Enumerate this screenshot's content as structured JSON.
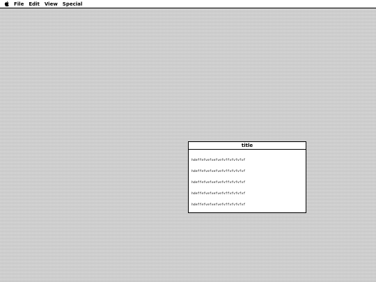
{
  "menubar": {
    "apple_icon": "apple-icon",
    "items": [
      {
        "label": "File"
      },
      {
        "label": "Edit"
      },
      {
        "label": "View"
      },
      {
        "label": "Special"
      }
    ]
  },
  "window": {
    "title": "title",
    "lines": [
      "hdeffefvefvefvefvffvfvfvfvf",
      "hdeffefvefvefvefvffvfvfvfvf",
      "hdeffefvefvefvefvffvfvfvfvf",
      "hdeffefvefvefvefvffvfvfvfvf",
      "hdeffefvefvefvefvffvfvfvfvf"
    ]
  }
}
